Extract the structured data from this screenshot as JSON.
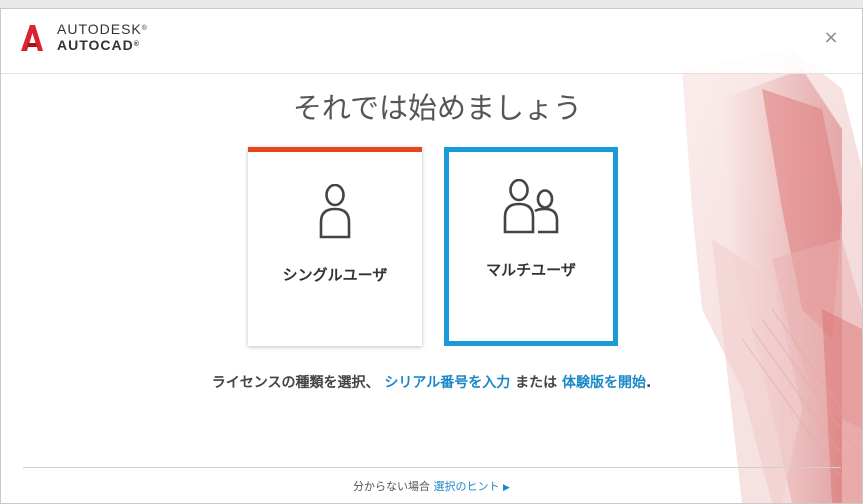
{
  "header": {
    "brand_line1": "AUTODESK",
    "brand_line2": "AUTOCAD",
    "trademark": "®",
    "close_glyph": "×"
  },
  "main": {
    "title": "それでは始めましょう",
    "cards": [
      {
        "label": "シングルユーザ",
        "icon": "single-user-icon"
      },
      {
        "label": "マルチユーザ",
        "icon": "multi-user-icon"
      }
    ],
    "hint": {
      "prefix": "ライセンスの種類を選択、",
      "serial_link": "シリアル番号を入力",
      "middle": "または",
      "trial_link": "体験版を開始",
      "suffix": "."
    }
  },
  "footer": {
    "prefix": "分からない場合",
    "link": "選択のヒント",
    "arrow": "▶"
  },
  "colors": {
    "accent_blue": "#1a9ad9",
    "accent_orange": "#e8451e",
    "brand_red": "#d9232e"
  }
}
